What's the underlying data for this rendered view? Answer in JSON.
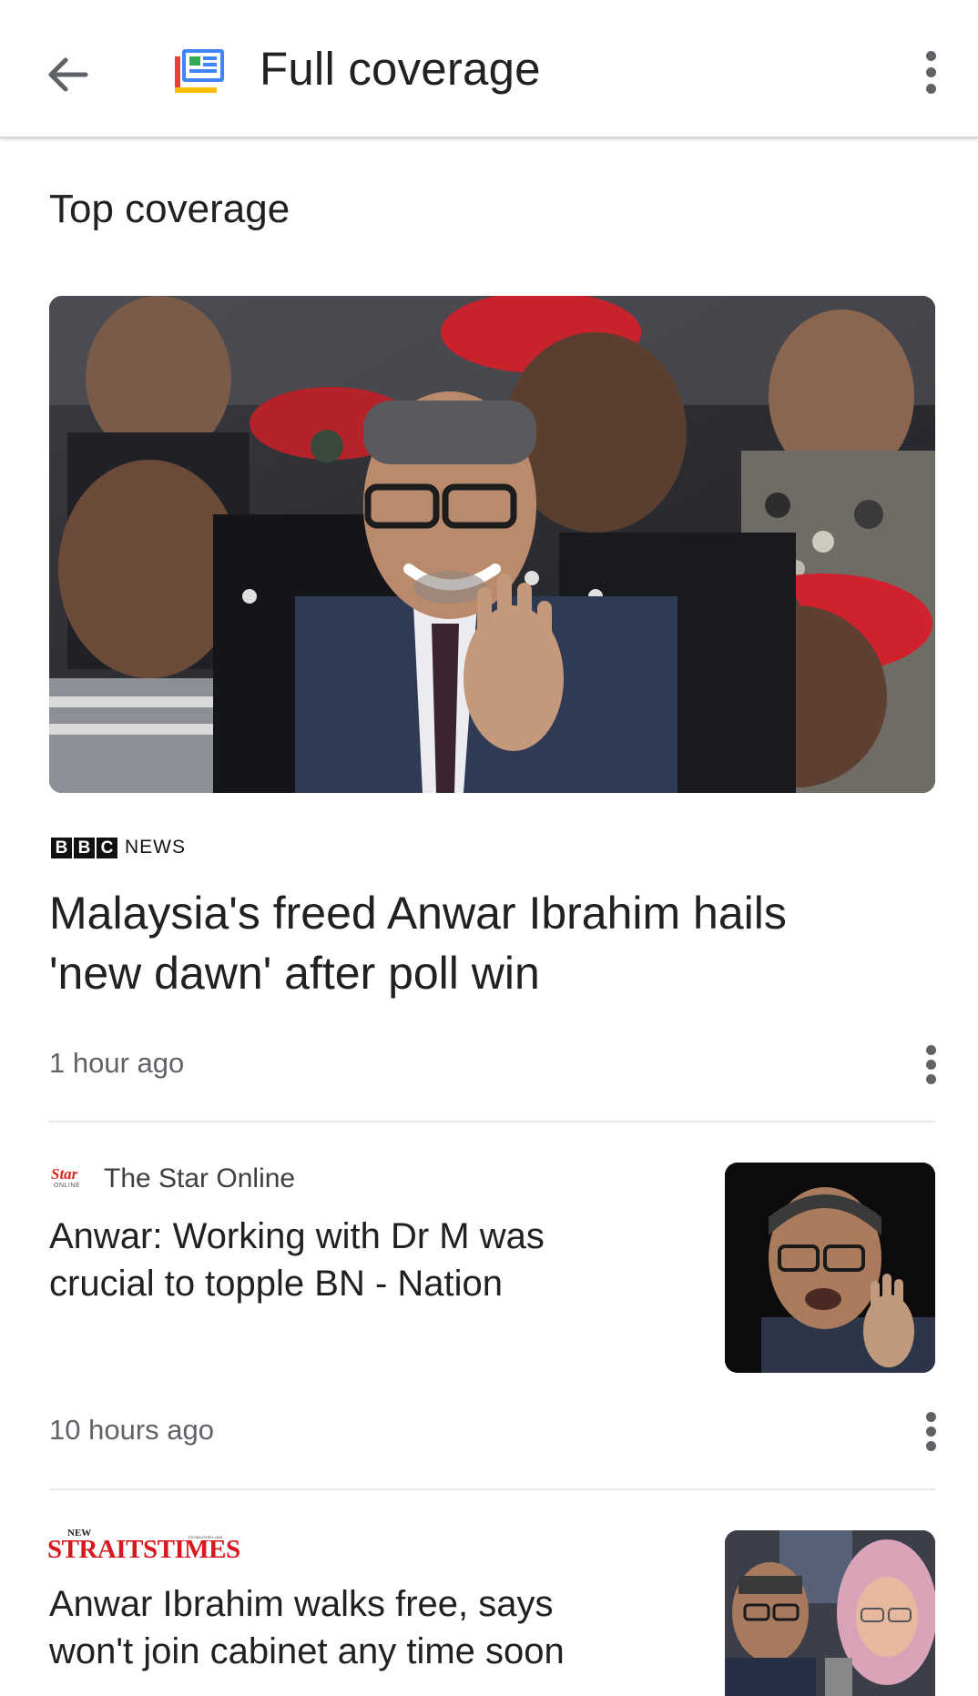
{
  "appbar": {
    "title": "Full coverage",
    "back_icon": "arrow-back-icon",
    "logo_icon": "google-news-logo-icon",
    "menu_icon": "more-vert-icon"
  },
  "section": {
    "title": "Top coverage"
  },
  "articles": [
    {
      "source": "BBC NEWS",
      "source_parts": [
        "B",
        "B",
        "C",
        "NEWS"
      ],
      "headline_line1": "Malaysia's freed Anwar Ibrahim hails",
      "headline_line2": "'new dawn' after poll win",
      "time": "1 hour ago"
    },
    {
      "source": "The Star Online",
      "logo_text": "Star",
      "logo_subtext": "ONLINE",
      "headline_line1": "Anwar: Working with Dr M was",
      "headline_line2": "crucial to topple BN - Nation",
      "time": "10 hours ago"
    },
    {
      "source": "NEW STRAITS TIMES",
      "logo_new": "NEW",
      "logo_main": "STRAITSTIMES",
      "logo_tagline": "ESTABLISHED 1845",
      "headline_line1": "Anwar Ibrahim walks free, says",
      "headline_line2": "won't join cabinet any time soon"
    }
  ],
  "colors": {
    "text_primary": "#202124",
    "text_secondary": "#5f6368",
    "divider": "#e8e8e8",
    "nst_red": "#d71920",
    "star_red": "#e2231a"
  }
}
